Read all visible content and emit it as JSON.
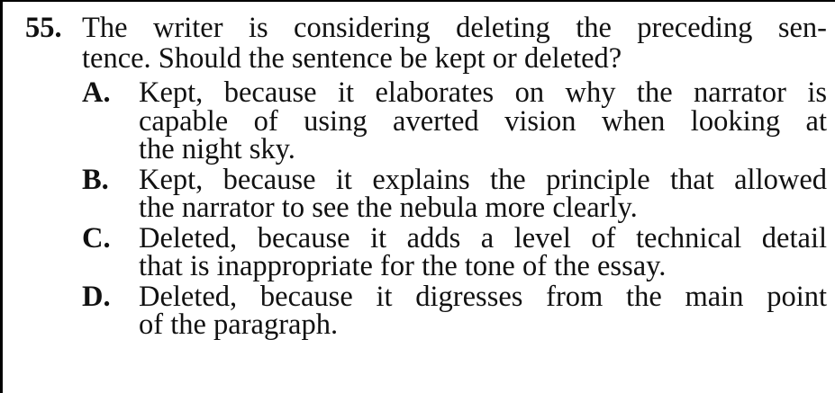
{
  "question": {
    "number": "55.",
    "stem_line1": "The writer is considering deleting the preceding sen-",
    "stem_line2": "tence. Should the sentence be kept or deleted?"
  },
  "options": [
    {
      "letter": "A.",
      "lines": [
        "Kept, because it elaborates on why the narrator is",
        "capable of using averted vision when looking at",
        "the night sky."
      ]
    },
    {
      "letter": "B.",
      "lines": [
        "Kept, because it explains the principle that allowed",
        "the narrator to see the nebula more clearly."
      ]
    },
    {
      "letter": "C.",
      "lines": [
        "Deleted, because it adds a level of technical detail",
        "that is inappropriate for the tone of the essay."
      ]
    },
    {
      "letter": "D.",
      "lines": [
        "Deleted, because it digresses from the main point",
        "of the paragraph."
      ]
    }
  ]
}
